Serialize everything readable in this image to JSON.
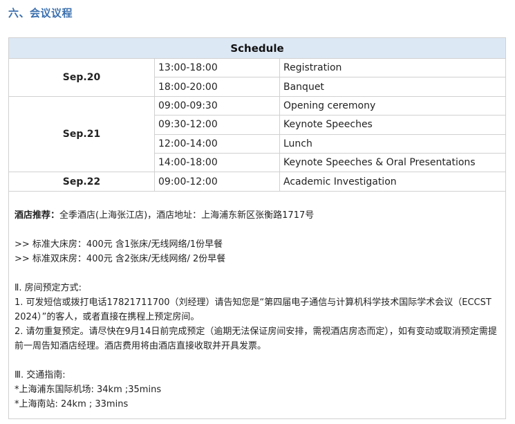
{
  "section": {
    "title": "六、会议议程"
  },
  "schedule": {
    "header": "Schedule",
    "days": [
      {
        "date": "Sep.20",
        "items": [
          {
            "time": "13:00-18:00",
            "event": "Registration"
          },
          {
            "time": "18:00-20:00",
            "event": "Banquet"
          }
        ]
      },
      {
        "date": "Sep.21",
        "items": [
          {
            "time": "09:00-09:30",
            "event": "Opening ceremony"
          },
          {
            "time": "09:30-12:00",
            "event": "Keynote Speeches"
          },
          {
            "time": "12:00-14:00",
            "event": "Lunch"
          },
          {
            "time": "14:00-18:00",
            "event": "Keynote Speeches & Oral Presentations"
          }
        ]
      },
      {
        "date": "Sep.22",
        "items": [
          {
            "time": "09:00-12:00",
            "event": "Academic Investigation"
          }
        ]
      }
    ]
  },
  "hotel": {
    "label": "酒店推荐：",
    "text": "全季酒店(上海张江店)，酒店地址：上海浦东新区张衡路1717号",
    "room_single": ">> 标准大床房：400元  含1张床/无线网络/1份早餐",
    "room_double": ">> 标准双床房：400元  含2张床/无线网络/ 2份早餐"
  },
  "booking": {
    "heading": "Ⅱ. 房间预定方式:",
    "step1": "1. 可发短信或拨打电话17821711700（刘经理）请告知您是“第四届电子通信与计算机科学技术国际学术会议（ECCST 2024）”的客人，或者直接在携程上预定房间。",
    "step2": " 2. 请勿重复预定。请尽快在9月14日前完成预定（逾期无法保证房间安排，需视酒店房态而定），如有变动或取消预定需提前一周告知酒店经理。酒店费用将由酒店直接收取并开具发票。"
  },
  "traffic": {
    "heading": "Ⅲ. 交通指南:",
    "airport": "*上海浦东国际机场: 34km ;35mins",
    "station": "*上海南站: 24km ; 33mins"
  }
}
